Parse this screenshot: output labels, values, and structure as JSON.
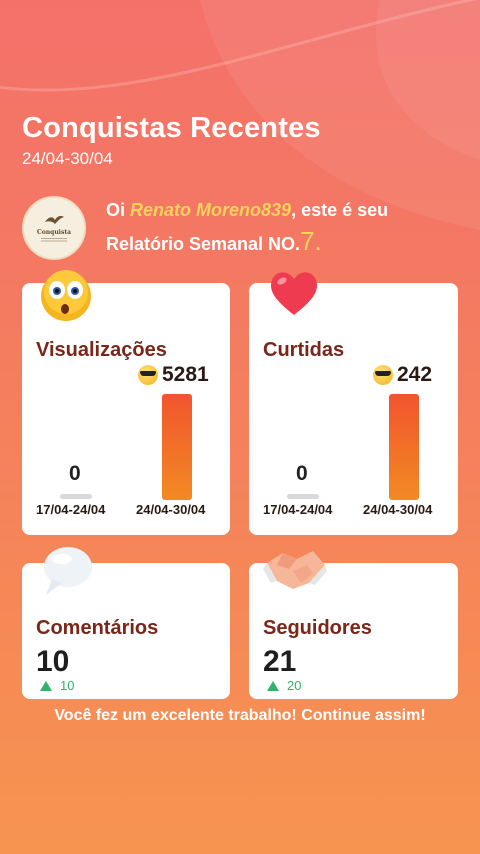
{
  "header": {
    "title": "Conquistas Recentes",
    "date_range": "24/04-30/04"
  },
  "greeting": {
    "prefix": "Oi ",
    "username": "Renato Moreno839",
    "suffix": ", este é seu",
    "line2": "Relatório Semanal NO.",
    "report_number": "7",
    "period": ".",
    "avatar_label": "Conquista"
  },
  "cards": {
    "views": {
      "label": "Visualizações",
      "current_value": "5281",
      "previous_value": "0",
      "previous_period": "17/04-24/04",
      "current_period": "24/04-30/04",
      "emoji": "dizzy-face-emoji"
    },
    "likes": {
      "label": "Curtidas",
      "current_value": "242",
      "previous_value": "0",
      "previous_period": "17/04-24/04",
      "current_period": "24/04-30/04",
      "emoji": "heart-emoji"
    },
    "comments": {
      "label": "Comentários",
      "value": "10",
      "delta": "10",
      "emoji": "speech-bubble-emoji"
    },
    "followers": {
      "label": "Seguidores",
      "value": "21",
      "delta": "20",
      "emoji": "handshake-emoji"
    }
  },
  "footer": {
    "message": "Você fez um excelente trabalho! Continue assim!"
  },
  "colors": {
    "accent_yellow": "#fcd25c",
    "label_brown": "#7a2618",
    "bar_top": "#f1542e",
    "bar_bottom": "#f38a23",
    "up_green": "#2fb56a"
  }
}
